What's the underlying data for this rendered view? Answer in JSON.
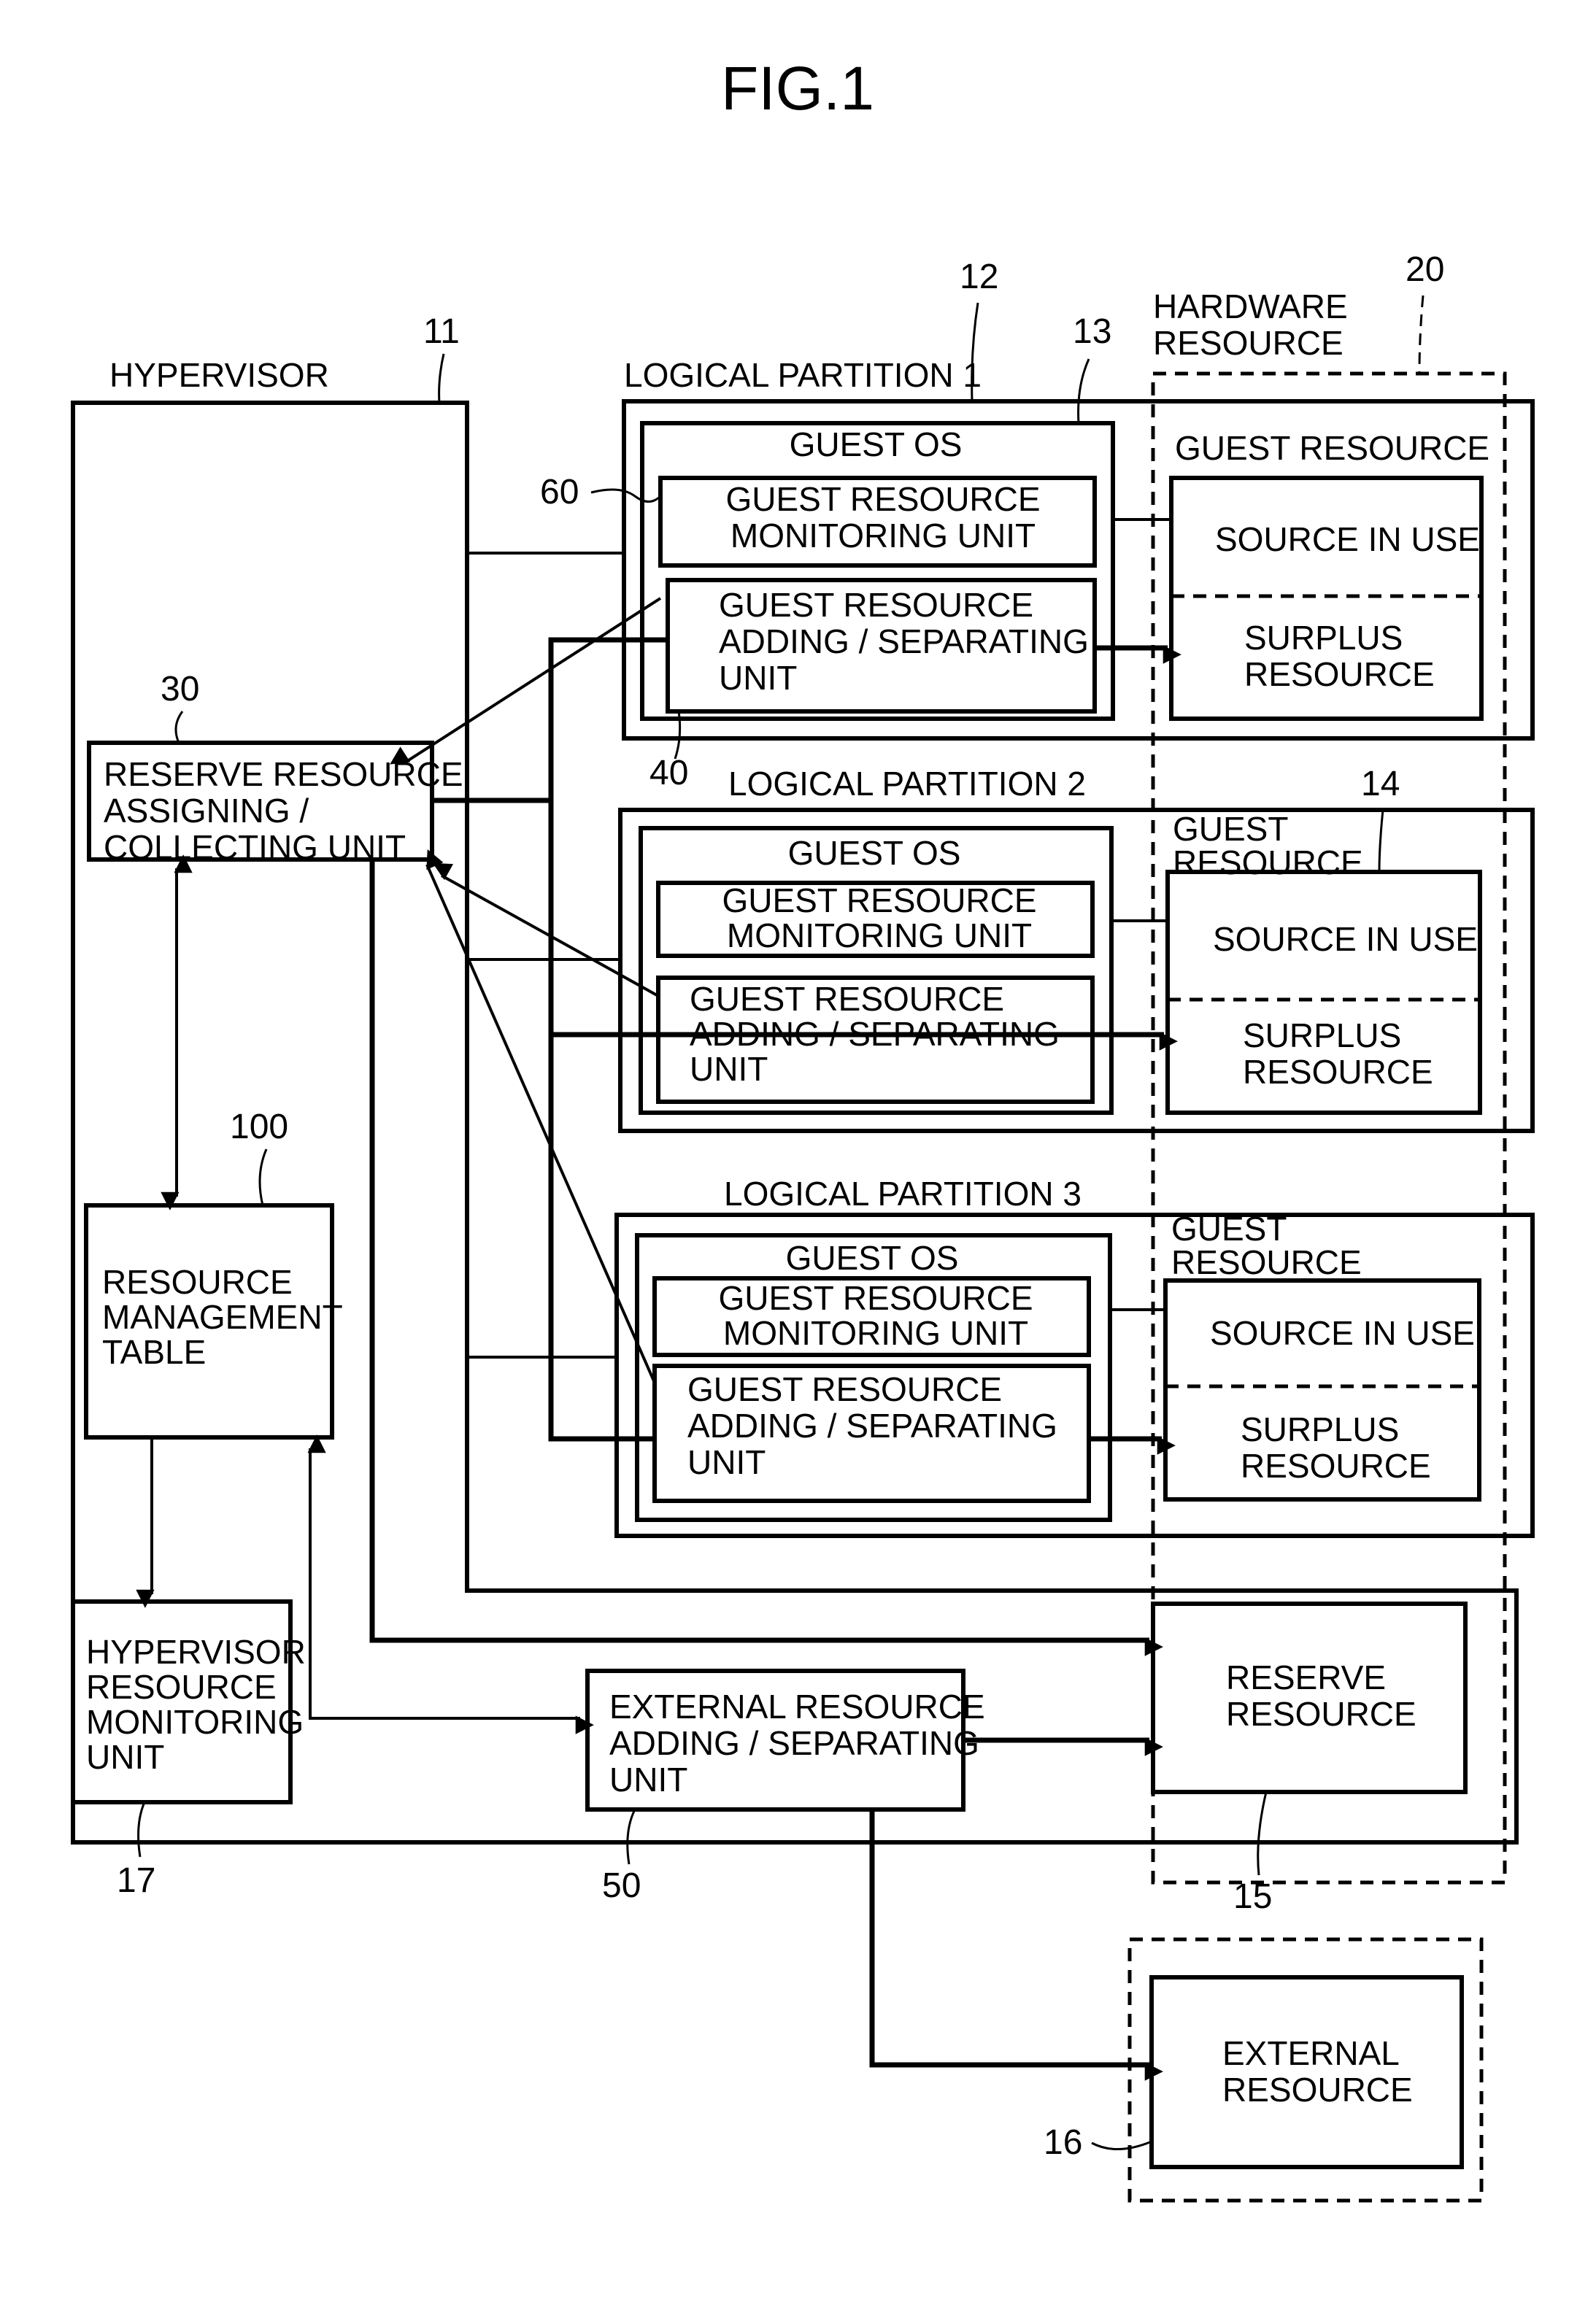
{
  "figure": {
    "title": "FIG.1"
  },
  "hypervisor": {
    "label": "HYPERVISOR",
    "ref": "11",
    "reserve_unit": {
      "ref": "30",
      "lines": [
        "RESERVE RESOURCE",
        "ASSIGNING /",
        "COLLECTING UNIT"
      ]
    },
    "mgmt_table": {
      "ref": "100",
      "lines": [
        "RESOURCE",
        "MANAGEMENT",
        "TABLE"
      ]
    },
    "hv_monitor": {
      "ref": "17",
      "lines": [
        "HYPERVISOR",
        "RESOURCE",
        "MONITORING",
        "UNIT"
      ]
    },
    "ext_unit": {
      "ref": "50",
      "lines": [
        "EXTERNAL RESOURCE",
        "ADDING / SEPARATING",
        "UNIT"
      ]
    }
  },
  "hardware": {
    "ref": "20",
    "lines": [
      "HARDWARE",
      "RESOURCE"
    ]
  },
  "partitions": [
    {
      "label": "LOGICAL PARTITION 1",
      "ref": "12",
      "guest_os_ref": "13",
      "guest_os": "GUEST OS",
      "monitor": {
        "ref": "60",
        "lines": [
          "GUEST RESOURCE",
          "MONITORING UNIT"
        ]
      },
      "adding": {
        "ref": "40",
        "lines": [
          "GUEST RESOURCE",
          "ADDING / SEPARATING",
          "UNIT"
        ]
      },
      "guest_resource": {
        "lines": [
          "GUEST RESOURCE"
        ],
        "in_use": "SOURCE IN USE",
        "surplus": [
          "SURPLUS",
          "RESOURCE"
        ]
      }
    },
    {
      "label": "LOGICAL PARTITION 2",
      "guest_os": "GUEST OS",
      "monitor": {
        "lines": [
          "GUEST RESOURCE",
          "MONITORING UNIT"
        ]
      },
      "adding": {
        "lines": [
          "GUEST RESOURCE",
          "ADDING / SEPARATING",
          "UNIT"
        ]
      },
      "guest_resource": {
        "ref": "14",
        "lines": [
          "GUEST",
          "RESOURCE"
        ],
        "in_use": "SOURCE IN USE",
        "surplus": [
          "SURPLUS",
          "RESOURCE"
        ]
      }
    },
    {
      "label": "LOGICAL PARTITION 3",
      "guest_os": "GUEST OS",
      "monitor": {
        "lines": [
          "GUEST RESOURCE",
          "MONITORING UNIT"
        ]
      },
      "adding": {
        "lines": [
          "GUEST RESOURCE",
          "ADDING / SEPARATING",
          "UNIT"
        ]
      },
      "guest_resource": {
        "lines": [
          "GUEST",
          "RESOURCE"
        ],
        "in_use": "SOURCE IN USE",
        "surplus": [
          "SURPLUS",
          "RESOURCE"
        ]
      }
    }
  ],
  "reserve_resource": {
    "ref": "15",
    "lines": [
      "RESERVE",
      "RESOURCE"
    ]
  },
  "external_resource": {
    "ref": "16",
    "lines": [
      "EXTERNAL",
      "RESOURCE"
    ]
  }
}
